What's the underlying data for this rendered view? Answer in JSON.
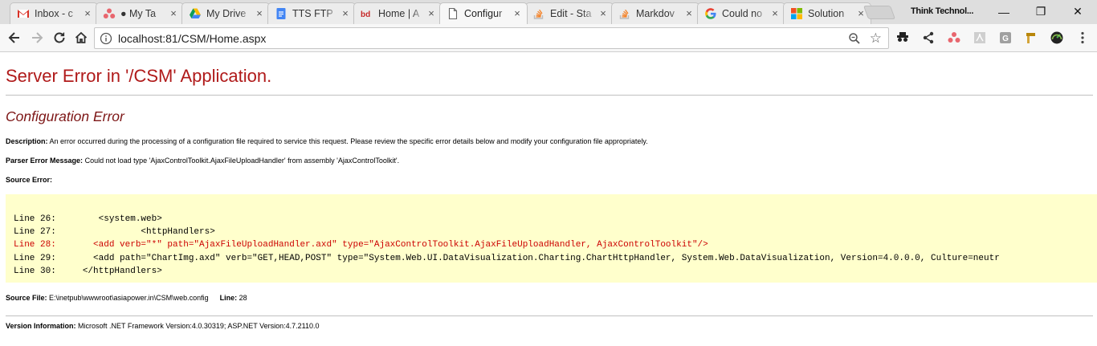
{
  "browser": {
    "tabs": [
      {
        "label": "Inbox - c",
        "icon": "gmail-icon",
        "active": false
      },
      {
        "label": "● My Ta",
        "icon": "asana-icon",
        "active": false
      },
      {
        "label": "My Drive",
        "icon": "google-drive-icon",
        "active": false
      },
      {
        "label": "TTS FTP",
        "icon": "google-docs-icon",
        "active": false
      },
      {
        "label": "Home | A",
        "icon": "bd-icon",
        "active": false
      },
      {
        "label": "Configur",
        "icon": "document-icon",
        "active": true
      },
      {
        "label": "Edit - Sta",
        "icon": "stackoverflow-icon",
        "active": false
      },
      {
        "label": "Markdov",
        "icon": "stackoverflow-icon",
        "active": false
      },
      {
        "label": "Could no",
        "icon": "google-icon",
        "active": false
      },
      {
        "label": "Solution",
        "icon": "microsoft-icon",
        "active": false
      }
    ],
    "tab_close": "×",
    "profile_name": "Think Technol...",
    "window": {
      "minimize": "—",
      "maximize": "❐",
      "close": "✕"
    },
    "address": "localhost:81/CSM/Home.aspx"
  },
  "page": {
    "title": "Server Error in '/CSM' Application.",
    "subtitle": "Configuration Error",
    "description_label": "Description:",
    "description_text": " An error occurred during the processing of a configuration file required to service this request. Please review the specific error details below and modify your configuration file appropriately.",
    "parser_label": "Parser Error Message:",
    "parser_text": " Could not load type 'AjaxControlToolkit.AjaxFileUploadHandler' from assembly 'AjaxControlToolkit'.",
    "source_error_label": "Source Error:",
    "source_lines": [
      {
        "text": "Line 26:        <system.web>",
        "highlight": false
      },
      {
        "text": "Line 27:                <httpHandlers>",
        "highlight": false
      },
      {
        "text": "Line 28:       <add verb=\"*\" path=\"AjaxFileUploadHandler.axd\" type=\"AjaxControlToolkit.AjaxFileUploadHandler, AjaxControlToolkit\"/>",
        "highlight": true
      },
      {
        "text": "Line 29:       <add path=\"ChartImg.axd\" verb=\"GET,HEAD,POST\" type=\"System.Web.UI.DataVisualization.Charting.ChartHttpHandler, System.Web.DataVisualization, Version=4.0.0.0, Culture=neutr",
        "highlight": false
      },
      {
        "text": "Line 30:     </httpHandlers>",
        "highlight": false
      }
    ],
    "source_file_label": "Source File:",
    "source_file_path": " E:\\inetpub\\wwwroot\\asiapower.in\\CSM\\web.config",
    "line_label": "Line:",
    "line_value": " 28",
    "version_label": "Version Information:",
    "version_text": " Microsoft .NET Framework Version:4.0.30319; ASP.NET Version:4.7.2110.0"
  },
  "colors": {
    "title": "#b01a1a",
    "subtitle": "#7d1616",
    "source_bg": "#ffffcc",
    "highlight_line": "#cc0000"
  }
}
